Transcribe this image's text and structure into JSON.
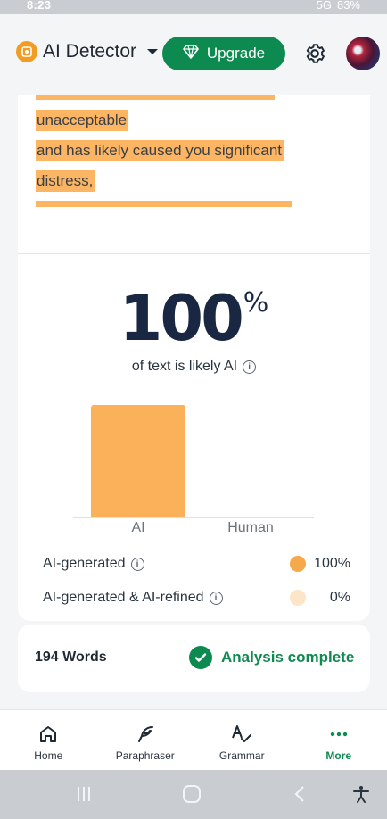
{
  "status_bar": {
    "time": "8:23",
    "signal": "5G",
    "battery": "83%"
  },
  "header": {
    "app_name": "AI Detector",
    "upgrade_label": "Upgrade"
  },
  "excerpt": {
    "lines": [
      "unacceptable",
      "and has likely caused you significant",
      "distress,"
    ]
  },
  "result": {
    "score": "100",
    "score_unit": "%",
    "subtitle": "of text is likely AI"
  },
  "chart_data": {
    "type": "bar",
    "categories": [
      "AI",
      "Human"
    ],
    "values": [
      100,
      0
    ],
    "ylim": [
      0,
      100
    ],
    "colors": [
      "#fbb15a",
      "#fde6c8"
    ]
  },
  "legend": [
    {
      "label": "AI-generated",
      "value": "100%",
      "color": "#f5a94b"
    },
    {
      "label": "AI-generated & AI-refined",
      "value": "0%",
      "color": "#fde6c8"
    }
  ],
  "summary": {
    "word_count": "194 Words",
    "status": "Analysis complete"
  },
  "nav": [
    {
      "label": "Home",
      "icon": "home-icon",
      "active": false
    },
    {
      "label": "Paraphraser",
      "icon": "feather-icon",
      "active": false
    },
    {
      "label": "Grammar",
      "icon": "grammar-check-icon",
      "active": false
    },
    {
      "label": "More",
      "icon": "more-dots-icon",
      "active": true
    }
  ],
  "colors": {
    "brand_green": "#0d8a4f",
    "accent_orange": "#f39c22",
    "highlight": "#fbb563"
  }
}
